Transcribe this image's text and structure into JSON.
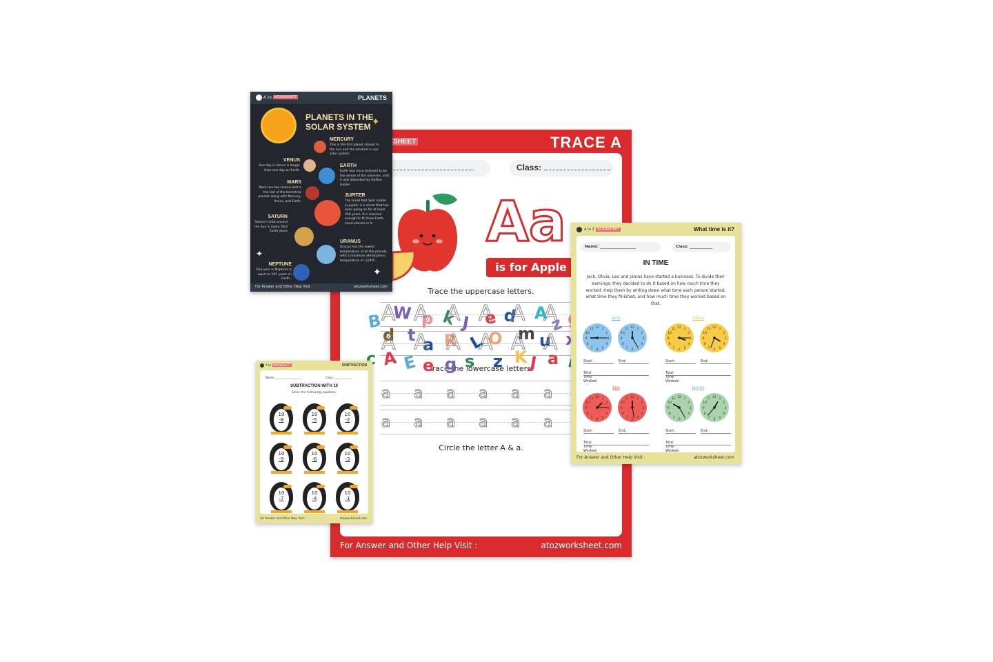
{
  "trace_sheet": {
    "brand_partial": "SHEET",
    "title": "TRACE A",
    "class_label": "Class:",
    "letters_display": "Aa",
    "banner": "is for Apple",
    "uppercase_instruction": "Trace the uppercase letters.",
    "uppercase_letter": "A",
    "lowercase_instruction": "Trace the lowercase letters.",
    "lowercase_letter": "a",
    "circle_instruction": "Circle the letter A & a.",
    "scatter_letters": [
      {
        "t": "B",
        "c": "#5aa9e0"
      },
      {
        "t": "W",
        "c": "#7b5fb5"
      },
      {
        "t": "p",
        "c": "#f08f8f"
      },
      {
        "t": "k",
        "c": "#2e8b57"
      },
      {
        "t": "J",
        "c": "#7b5fb5"
      },
      {
        "t": "e",
        "c": "#e63946"
      },
      {
        "t": "d",
        "c": "#1f4fa0"
      },
      {
        "t": "A",
        "c": "#2ab7ca"
      },
      {
        "t": "z",
        "c": "#8e7cc3"
      },
      {
        "t": "g",
        "c": "#f08f8f"
      },
      {
        "t": "d",
        "c": "#7a5c2e"
      },
      {
        "t": "t",
        "c": "#7b5fb5"
      },
      {
        "t": "a",
        "c": "#1f4fa0"
      },
      {
        "t": "R",
        "c": "#f4a27a"
      },
      {
        "t": "L",
        "c": "#1f4fa0"
      },
      {
        "t": "O",
        "c": "#f4a27a"
      },
      {
        "t": "m",
        "c": "#444444"
      },
      {
        "t": "u",
        "c": "#1f4fa0"
      },
      {
        "t": "x",
        "c": "#7b5fb5"
      },
      {
        "t": "c",
        "c": "#2e8b57"
      },
      {
        "t": "A",
        "c": "#e63946"
      },
      {
        "t": "E",
        "c": "#5aa9e0"
      },
      {
        "t": "e",
        "c": "#e63946"
      },
      {
        "t": "g",
        "c": "#7b5fb5"
      },
      {
        "t": "s",
        "c": "#2e8b57"
      },
      {
        "t": "z",
        "c": "#1f4fa0"
      },
      {
        "t": "K",
        "c": "#f4c04e"
      },
      {
        "t": "J",
        "c": "#e63946"
      },
      {
        "t": "a",
        "c": "#e63946"
      },
      {
        "t": "N",
        "c": "#2e8b57"
      }
    ],
    "footer_left": "For Answer and Other Help Visit :",
    "footer_right": "atozworksheet.com",
    "accent": "#d92b2e"
  },
  "planets_sheet": {
    "brand": "A to Z",
    "brand_tag": "WORKSHEET",
    "header": "PLANETS",
    "title_line1": "PLANETS IN THE",
    "title_line2": "SOLAR SYSTEM",
    "planets": [
      {
        "name": "MERCURY",
        "desc": "This is the first planet closest to the Sun and the smallest in our solar system.",
        "color": "#d9603a"
      },
      {
        "name": "VENUS",
        "desc": "One day in Venus is longer than one day on Earth.",
        "color": "#e0b48a"
      },
      {
        "name": "EARTH",
        "desc": "Earth was once believed to be the center of the universe, until it was debunked by Galileo Galilei.",
        "color": "#3f8fd6"
      },
      {
        "name": "MARS",
        "desc": "Mars has two moons and is the last of the terrestrial planets along with Mercury, Venus, and Earth.",
        "color": "#b5392e"
      },
      {
        "name": "JUPITER",
        "desc": "The Great Red Spot visible in Jupiter is a storm that has been going on for at least 350 years. It is massive enough to fit three Earth-sized planets in it.",
        "color": "#e8553a"
      },
      {
        "name": "SATURN",
        "desc": "Saturn's orbit around the Sun is every 29.4 Earth years",
        "color": "#d4a24c"
      },
      {
        "name": "URANUS",
        "desc": "Uranus has the lowest temperature of all the planets, with a minimum atmospheric temperature of -224ºC.",
        "color": "#7db4e0"
      },
      {
        "name": "NEPTUNE",
        "desc": "One year in Neptune is equal to 165 years on Earth .",
        "color": "#2f63b8"
      }
    ],
    "footer_left": "For Answer and Other Help Visit :",
    "footer_right": "atozworksheet.com"
  },
  "time_sheet": {
    "brand": "A to Z",
    "brand_tag": "WORKSHEET",
    "header": "What time is it?",
    "name_label": "Name: ___________________",
    "class_label": "Class: ____________",
    "title": "IN TIME",
    "instructions": "Jack, Olivia, Leo and James have started a business. To divide their earnings, they decided to do it based on how much time they worked. Help them by writing down what time each person started, what time they finished, and how much time they worked based on that.",
    "people": [
      {
        "name": "Jack",
        "color": "#8ec5ea",
        "name_color": "#6fb6e6"
      },
      {
        "name": "Olivia",
        "color": "#f7cb45",
        "name_color": "#f0c43a"
      },
      {
        "name": "Leo",
        "color": "#ef5b57",
        "name_color": "#e8524e"
      },
      {
        "name": "James",
        "color": "#a9d3a9",
        "name_color": "#6fb6e6"
      }
    ],
    "start_label": "Start:",
    "end_label": "End:",
    "total_label": "Total Time Worked:",
    "footer_left": "For Answer and Other Help Visit :",
    "footer_right": "atozworksheet.com"
  },
  "subtraction_sheet": {
    "brand": "A to Z",
    "brand_tag": "WORKSHEET",
    "header": "SUBTRACTION",
    "name_label": "Name: ___________________",
    "class_label": "Class: ____________",
    "title": "SUBTRACTION WITH 10",
    "subtitle": "Solve the following equation.",
    "problems": [
      {
        "a": "10",
        "b": "-8"
      },
      {
        "a": "10",
        "b": "-5"
      },
      {
        "a": "10",
        "b": "-2"
      },
      {
        "a": "10",
        "b": "-9"
      },
      {
        "a": "10",
        "b": "-6"
      },
      {
        "a": "10",
        "b": "-3"
      },
      {
        "a": "10",
        "b": "-7"
      },
      {
        "a": "10",
        "b": "-4"
      },
      {
        "a": "10",
        "b": "-1"
      }
    ],
    "footer_left": "For Answer and Other Help Visit :",
    "footer_right": "atozworksheet.com"
  }
}
